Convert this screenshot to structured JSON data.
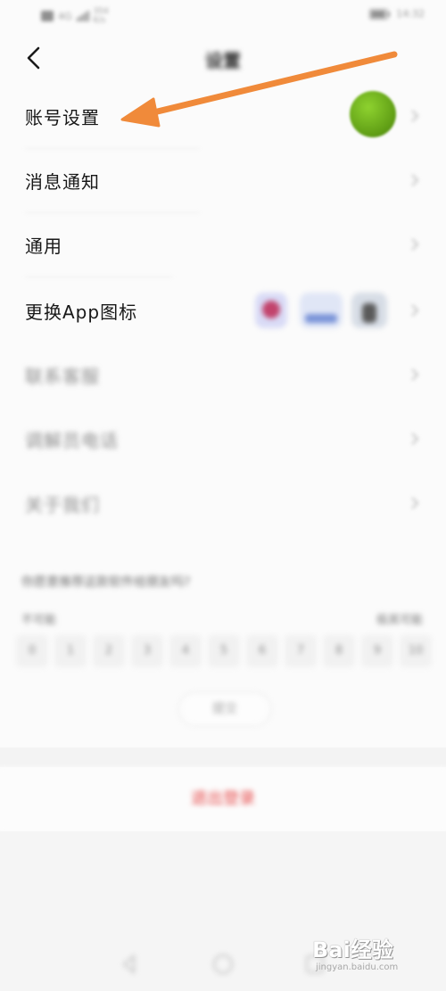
{
  "status_bar": {
    "network_tag": "4G",
    "speed_value": "354",
    "speed_unit": "K/s",
    "time": "14:32"
  },
  "header": {
    "title": "设置"
  },
  "settings": {
    "account": "账号设置",
    "notifications": "消息通知",
    "general": "通用",
    "change_app_icon": "更换App图标",
    "contact_support": "联系客服",
    "dispatcher": "调解员电话",
    "about": "关于我们"
  },
  "survey": {
    "question": "你愿意推荐这款软件给朋友吗?",
    "low_label": "不可能",
    "high_label": "极其可能",
    "scale": [
      "0",
      "1",
      "2",
      "3",
      "4",
      "5",
      "6",
      "7",
      "8",
      "9",
      "10"
    ],
    "submit": "提交"
  },
  "logout": {
    "label": "退出登录"
  },
  "watermark": {
    "logo": "Bai经验",
    "url": "jingyan.baidu.com"
  },
  "colors": {
    "arrow": "#f08a3a",
    "logout_text": "#e64a4a",
    "avatar": "#6faf1c"
  },
  "icons": [
    "back-chevron",
    "chevron-right",
    "signal-bars",
    "battery",
    "avatar-ball",
    "annotation-arrow"
  ]
}
